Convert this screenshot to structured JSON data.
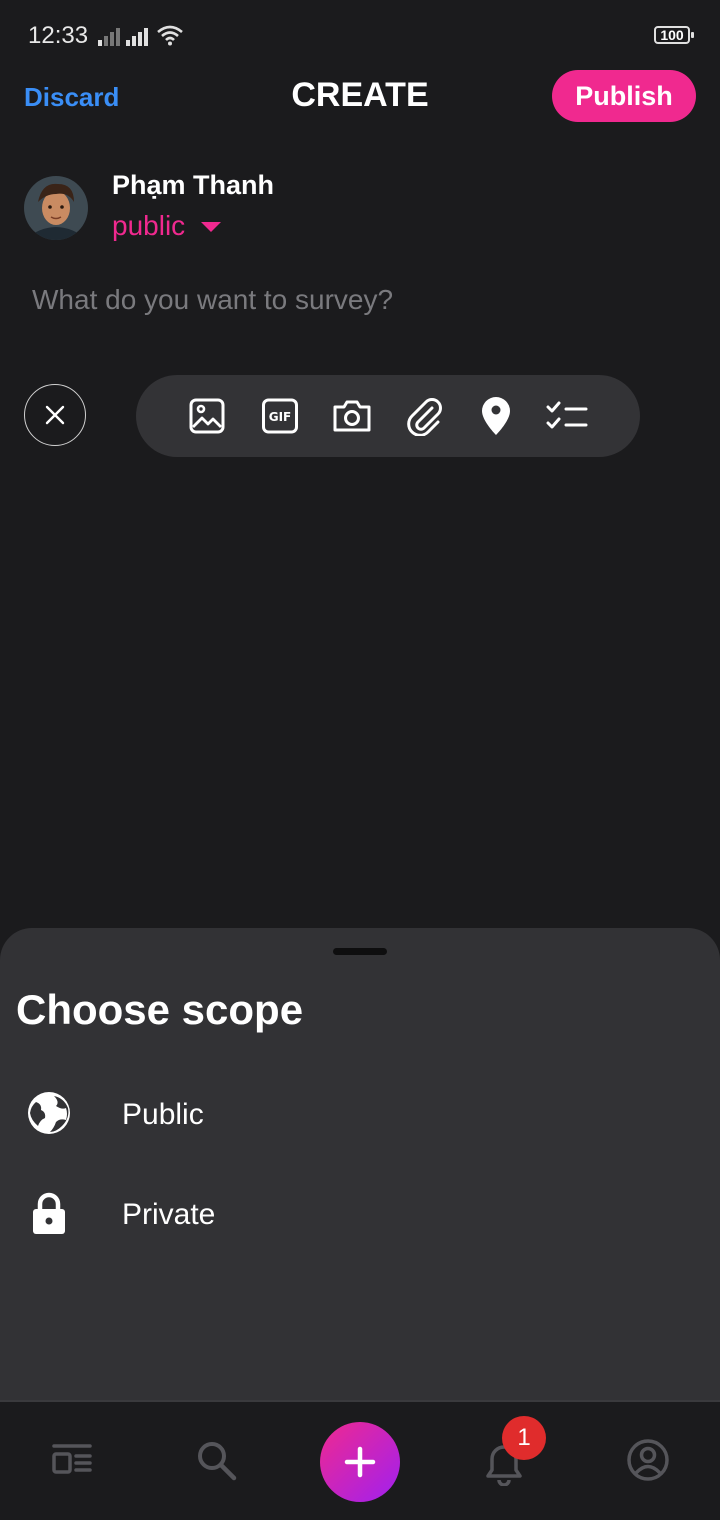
{
  "status_bar": {
    "time": "12:33",
    "battery": "100"
  },
  "header": {
    "discard_label": "Discard",
    "title": "CREATE",
    "publish_label": "Publish"
  },
  "composer": {
    "user_name": "Phạm Thanh",
    "scope_value": "public",
    "placeholder": "What do you want to survey?"
  },
  "toolbar": {
    "icons": [
      "image-icon",
      "gif-icon",
      "camera-icon",
      "attachment-icon",
      "location-icon",
      "checklist-icon"
    ],
    "gif_text": "GIF"
  },
  "scope_sheet": {
    "title": "Choose scope",
    "options": [
      {
        "label": "Public",
        "icon": "globe-icon"
      },
      {
        "label": "Private",
        "icon": "lock-icon"
      }
    ]
  },
  "bottom_nav": {
    "items": [
      "feed-icon",
      "search-icon",
      "add-icon",
      "bell-icon",
      "profile-icon"
    ],
    "notification_count": "1"
  },
  "colors": {
    "accent": "#f0298f",
    "link": "#3a8ef6",
    "background": "#1b1b1d",
    "sheet": "#323235",
    "badge": "#e02c2c"
  }
}
